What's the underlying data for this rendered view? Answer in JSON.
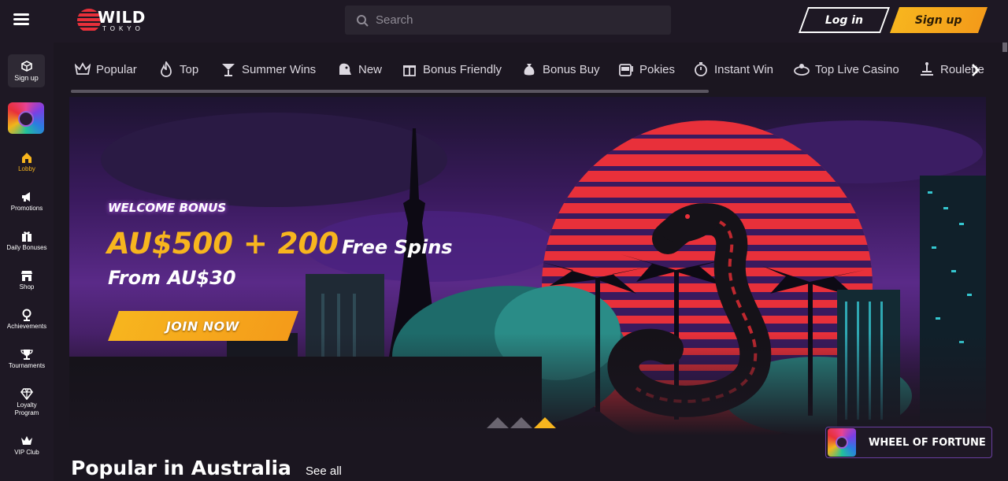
{
  "header": {
    "logo_wild": "WILD",
    "logo_tokyo": "TOKYO",
    "search_placeholder": "Search",
    "login_label": "Log in",
    "signup_label": "Sign up"
  },
  "sidebar": {
    "signup_label": "Sign up",
    "items": [
      {
        "label": "Lobby",
        "icon": "home-icon",
        "active": true
      },
      {
        "label": "Promotions",
        "icon": "megaphone-icon"
      },
      {
        "label": "Daily Bonuses",
        "icon": "gift-icon"
      },
      {
        "label": "Shop",
        "icon": "shop-icon"
      },
      {
        "label": "Achievements",
        "icon": "medal-icon"
      },
      {
        "label": "Tournaments",
        "icon": "trophy-icon"
      },
      {
        "label": "Loyalty Program",
        "icon": "diamond-icon"
      },
      {
        "label": "VIP Club",
        "icon": "crown-icon"
      }
    ]
  },
  "categories": [
    {
      "label": "Popular",
      "icon": "crown-icon"
    },
    {
      "label": "Top",
      "icon": "flame-icon"
    },
    {
      "label": "Summer Wins",
      "icon": "cocktail-icon"
    },
    {
      "label": "New",
      "icon": "new-icon"
    },
    {
      "label": "Bonus Friendly",
      "icon": "gift-icon"
    },
    {
      "label": "Bonus Buy",
      "icon": "moneybag-icon"
    },
    {
      "label": "Pokies",
      "icon": "slot-machine-icon"
    },
    {
      "label": "Instant Win",
      "icon": "stopwatch-icon"
    },
    {
      "label": "Top Live Casino",
      "icon": "live-casino-icon"
    },
    {
      "label": "Roulette",
      "icon": "roulette-icon"
    }
  ],
  "banner": {
    "welcome": "WELCOME BONUS",
    "amount": "AU$500 + 200",
    "free_spins": "Free Spins",
    "from": "From AU$30",
    "cta": "JOIN NOW"
  },
  "wheel_of_fortune": "WHEEL OF FORTUNE",
  "section": {
    "title": "Popular in Australia",
    "see_all": "See all"
  },
  "colors": {
    "accent": "#f7b51e",
    "background": "#1b1620",
    "sidebar": "#1e1824"
  }
}
